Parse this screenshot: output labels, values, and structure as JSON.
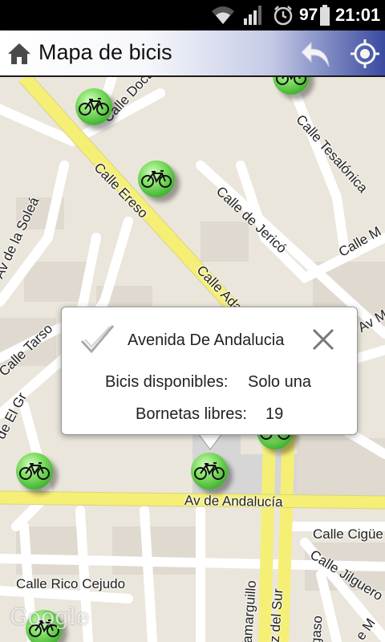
{
  "status_bar": {
    "battery": "97",
    "time": "21:01"
  },
  "header": {
    "title": "Mapa de bicis"
  },
  "map": {
    "streets": [
      "Calle Doctor",
      "Calle Tesalónica",
      "Calle Ereso",
      "Calle de Jericó",
      "Av de la Soleá",
      "Calle M",
      "Calle Ada",
      "Calle Tarso",
      "Av Mo",
      "de El Gr",
      "Av de Andalucía",
      "Calle Cigüe",
      "Calle Jilguero",
      "Calle Rico Cejudo",
      "Tamarguillo",
      "uz del Sur",
      "gaso",
      "e M"
    ],
    "attribution": "Google"
  },
  "info": {
    "station_name": "Avenida De Andalucia",
    "bikes_label": "Bicis disponibles:",
    "bikes_value": "Solo una",
    "slots_label": "Bornetas libres:",
    "slots_value": "19"
  },
  "colors": {
    "main_road": "#f5ef76",
    "minor_road": "#ffffff",
    "land": "#ebe6dc",
    "block": "#dfd9cf",
    "marker": "#49b736"
  }
}
